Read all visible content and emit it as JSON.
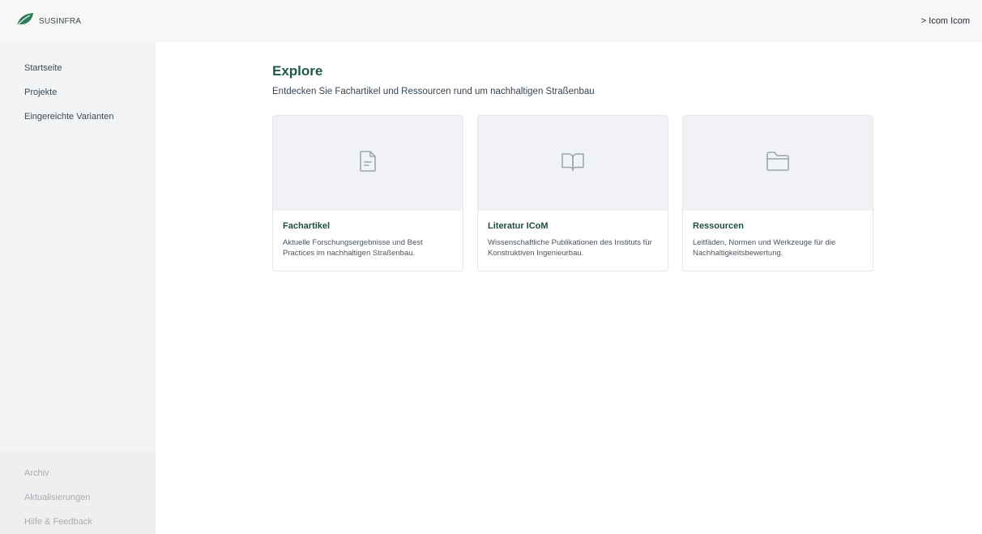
{
  "header": {
    "brand_name": "SUSINFRA",
    "brand_color": "#2f7d5a",
    "user_label": "> Icom Icom"
  },
  "sidebar": {
    "items": [
      {
        "label": "Startseite"
      },
      {
        "label": "Projekte"
      },
      {
        "label": "Eingereichte Varianten"
      }
    ],
    "bottom_items": [
      {
        "label": "Archiv"
      },
      {
        "label": "Aktualisierungen"
      },
      {
        "label": "Hilfe & Feedback"
      }
    ]
  },
  "main": {
    "title": "Explore",
    "subtitle": "Entdecken Sie Fachartikel und Ressourcen rund um nachhaltigen Straßenbau",
    "cards": [
      {
        "icon": "document-icon",
        "title": "Fachartikel",
        "description": "Aktuelle Forschungsergebnisse und Best Practices im nachhaltigen Straßenbau."
      },
      {
        "icon": "book-icon",
        "title": "Literatur ICoM",
        "description": "Wissenschaftliche Publikationen des Instituts für Konstruktiven Ingenieurbau."
      },
      {
        "icon": "folder-icon",
        "title": "Ressourcen",
        "description": "Leitfäden, Normen und Werkzeuge für die Nachhaltigkeitsbewertung."
      }
    ]
  }
}
